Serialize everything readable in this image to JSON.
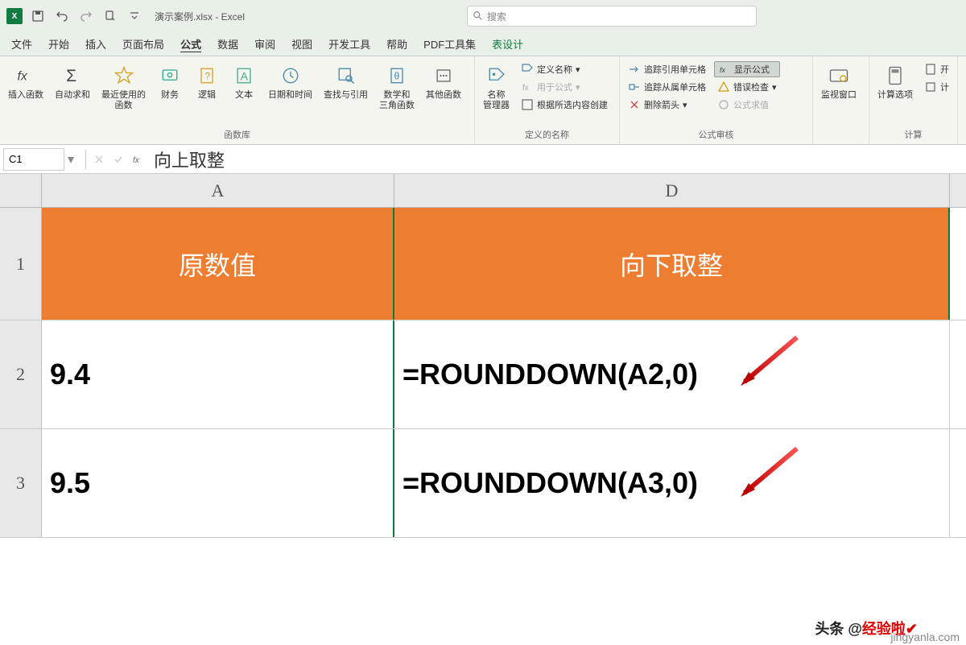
{
  "title": "演示案例.xlsx - Excel",
  "search": {
    "placeholder": "搜索"
  },
  "tabs": [
    "文件",
    "开始",
    "插入",
    "页面布局",
    "公式",
    "数据",
    "审阅",
    "视图",
    "开发工具",
    "帮助",
    "PDF工具集",
    "表设计"
  ],
  "active_tab": "公式",
  "ribbon": {
    "insert_fn": "插入函数",
    "autosum": "自动求和",
    "recent": "最近使用的\n函数",
    "financial": "财务",
    "logical": "逻辑",
    "text": "文本",
    "datetime": "日期和时间",
    "lookup": "查找与引用",
    "math": "数学和\n三角函数",
    "other": "其他函数",
    "lib_label": "函数库",
    "name_mgr": "名称\n管理器",
    "define_name": "定义名称",
    "use_formula": "用于公式",
    "create_from": "根据所选内容创建",
    "names_label": "定义的名称",
    "trace_prec": "追踪引用单元格",
    "trace_dep": "追踪从属单元格",
    "remove_arrows": "删除箭头",
    "show_formulas": "显示公式",
    "error_check": "错误检查",
    "eval_formula": "公式求值",
    "audit_label": "公式审核",
    "watch": "监视窗口",
    "calc_options": "计算选项",
    "calc_now": "开",
    "calc_sheet": "计",
    "calc_label": "计算"
  },
  "name_box": "C1",
  "formula": "向上取整",
  "columns": {
    "a": "A",
    "d": "D"
  },
  "rows": [
    "1",
    "2",
    "3"
  ],
  "cells": {
    "a1": "原数值",
    "d1": "向下取整",
    "a2": "9.4",
    "d2": "=ROUNDDOWN(A2,0)",
    "a3": "9.5",
    "d3": "=ROUNDDOWN(A3,0)"
  },
  "watermark1_a": "头条 @",
  "watermark1_b": "经验啦",
  "watermark2": "jingyanla.com"
}
